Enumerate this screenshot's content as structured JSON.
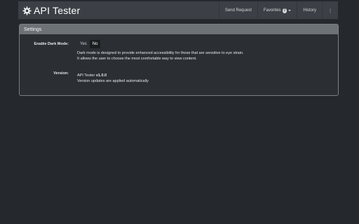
{
  "app": {
    "title": "API Tester"
  },
  "nav": {
    "send_request": "Send Request",
    "favorites": "Favorites",
    "favorites_count": "2",
    "history": "History",
    "menu": "⋮"
  },
  "settings": {
    "header": "Settings",
    "dark_mode": {
      "label": "Enable Dark Mode:",
      "yes": "Yes",
      "no": "No",
      "selected": "No",
      "description_line1": "Dark mode is designed to provide enhanced accessibility for those that are sensitive to eye strain.",
      "description_line2": "It allows the user to choose the most comfortable way to view content."
    },
    "version": {
      "label": "Version:",
      "product": "API Tester",
      "number": "v1.0.0",
      "note": "Version updates are applied automatically"
    }
  },
  "icons": {
    "brand": "gear-icon",
    "dropdown": "caret-down-icon",
    "more": "vertical-ellipsis-icon"
  },
  "colors": {
    "background": "#25282d",
    "navbar": "#3c4046",
    "panel": "#2b2f34",
    "panel_header": "#6d7277",
    "selected_toggle": "#1b1d20"
  }
}
